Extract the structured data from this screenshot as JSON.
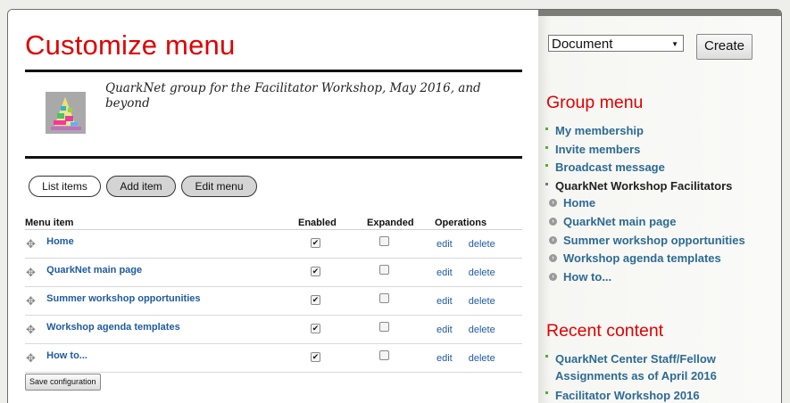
{
  "main": {
    "title": "Customize menu",
    "group_description": "QuarkNet group for the Facilitator Workshop, May 2016, and beyond",
    "tabs": [
      {
        "label": "List items",
        "active": true
      },
      {
        "label": "Add item",
        "active": false
      },
      {
        "label": "Edit menu",
        "active": false
      }
    ],
    "table": {
      "headers": [
        "Menu item",
        "Enabled",
        "Expanded",
        "Operations"
      ],
      "rows": [
        {
          "label": "Home",
          "enabled": true,
          "expanded": false,
          "edit": "edit",
          "delete": "delete"
        },
        {
          "label": "QuarkNet main page",
          "enabled": true,
          "expanded": false,
          "edit": "edit",
          "delete": "delete"
        },
        {
          "label": "Summer workshop opportunities",
          "enabled": true,
          "expanded": false,
          "edit": "edit",
          "delete": "delete"
        },
        {
          "label": "Workshop agenda templates",
          "enabled": true,
          "expanded": false,
          "edit": "edit",
          "delete": "delete"
        },
        {
          "label": "How to...",
          "enabled": true,
          "expanded": false,
          "edit": "edit",
          "delete": "delete"
        }
      ]
    },
    "save_label": "Save configuration"
  },
  "sidebar": {
    "select_value": "Document",
    "create_label": "Create",
    "group_menu": {
      "title": "Group menu",
      "items": [
        "My membership",
        "Invite members",
        "Broadcast message"
      ],
      "current_group": "QuarkNet Workshop Facilitators",
      "sub_items": [
        "Home",
        "QuarkNet main page",
        "Summer workshop opportunities",
        "Workshop agenda templates",
        "How to..."
      ]
    },
    "recent_content": {
      "title": "Recent content",
      "items": [
        "QuarkNet Center Staff/Fellow Assignments as of April 2016",
        "Facilitator Workshop 2016"
      ]
    }
  },
  "colors": {
    "title_red": "#e00000",
    "link_blue": "#2d6b93",
    "bullet_green": "#5aa83a"
  },
  "icons": {
    "drag_handle": "drag-handle-icon",
    "checkbox_checked": "checkmark-icon",
    "sub_bullet": "chevron-right-circle-icon",
    "select_arrow": "dropdown-arrow-icon"
  }
}
